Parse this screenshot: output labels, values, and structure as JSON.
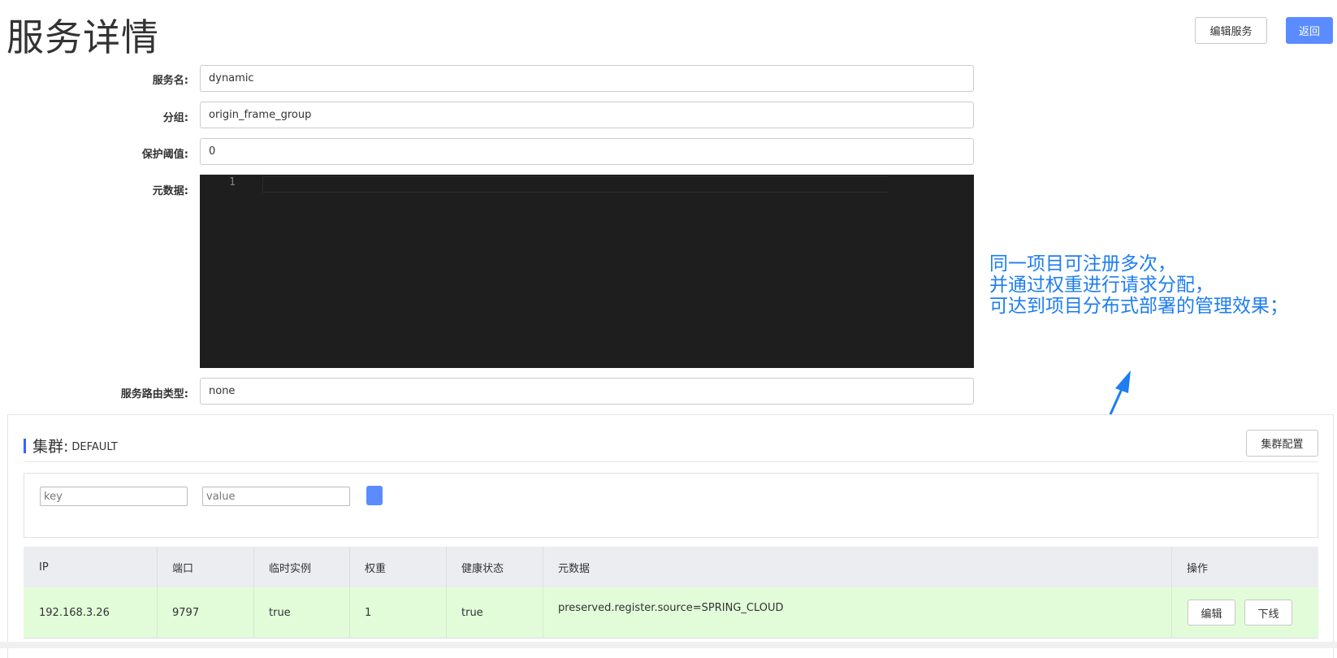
{
  "header": {
    "title": "服务详情",
    "edit_button": "编辑服务",
    "back_button": "返回"
  },
  "form": {
    "service_name_label": "服务名:",
    "service_name_value": "dynamic",
    "group_label": "分组:",
    "group_value": "origin_frame_group",
    "threshold_label": "保护阈值:",
    "threshold_value": "0",
    "metadata_label": "元数据:",
    "metadata_line_number": "1",
    "route_type_label": "服务路由类型:",
    "route_type_value": "none"
  },
  "annotation": {
    "line1": "同一项目可注册多次，",
    "line2": "并通过权重进行请求分配，",
    "line3": "可达到项目分布式部署的管理效果；",
    "color": "#1e7df0"
  },
  "cluster": {
    "title": "集群:",
    "name": "DEFAULT",
    "config_button": "集群配置",
    "filter_key_placeholder": "key",
    "filter_value_placeholder": "value"
  },
  "table": {
    "columns": [
      "IP",
      "端口",
      "临时实例",
      "权重",
      "健康状态",
      "元数据",
      "操作"
    ],
    "rows": [
      {
        "ip": "192.168.3.26",
        "port": "9797",
        "ephemeral": "true",
        "weight": "1",
        "healthy": "true",
        "metadata": "preserved.register.source=SPRING_CLOUD",
        "edit_label": "编辑",
        "offline_label": "下线"
      }
    ]
  },
  "colors": {
    "primary": "#5b8cff",
    "editor_bg": "#1e1e1e",
    "row_bg": "#e2fcd9",
    "header_bg": "#ebedf1"
  }
}
